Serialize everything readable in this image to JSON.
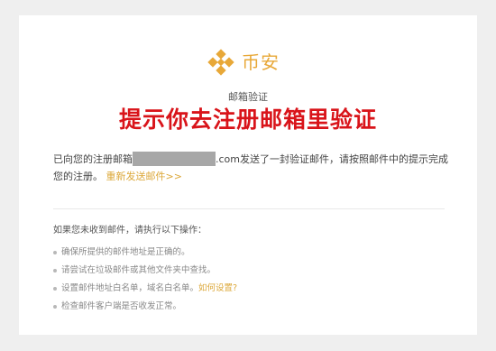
{
  "brand": {
    "logo_icon": "binance-diamond-icon",
    "name": "币安",
    "color": "#e8a838"
  },
  "email": {
    "subtitle": "邮箱验证",
    "overlay_title": "提示你去注册邮箱里验证",
    "sent_prefix": "已向您的注册邮箱",
    "masked_email_suffix": ".com",
    "sent_suffix": "发送了一封验证邮件，请按照邮件中的提示完成您的注册。",
    "resend_link": "重新发送邮件>>"
  },
  "help": {
    "heading": "如果您未收到邮件，请执行以下操作：",
    "items": [
      {
        "text": "确保所提供的邮件地址是正确的。"
      },
      {
        "text": "请尝试在垃圾邮件或其他文件夹中查找。"
      },
      {
        "text": "设置邮件地址白名单，域名白名单。",
        "link": "如何设置?"
      },
      {
        "text": "检查邮件客户端是否收发正常。"
      }
    ]
  },
  "colors": {
    "accent": "#dca83a",
    "overlay": "#d9141a"
  }
}
